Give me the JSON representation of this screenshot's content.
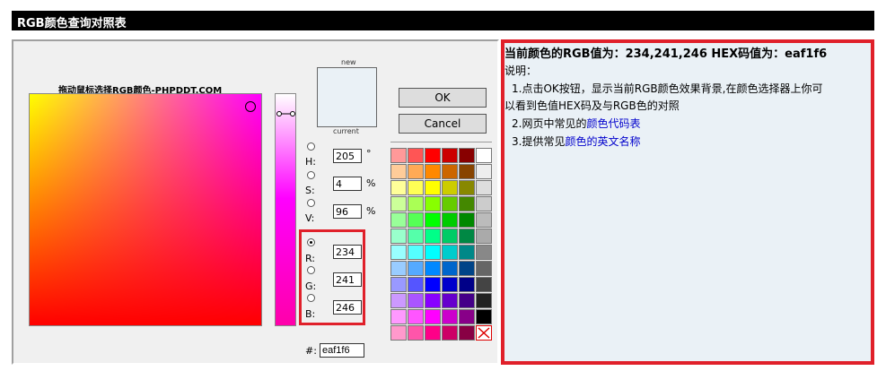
{
  "title": "RGB颜色查询对照表",
  "picker": {
    "drag_caption": "拖动鼠标选择RGB颜色-PHPDDT.COM",
    "new_label": "new",
    "current_label": "current",
    "current_color": "#eaf1f6",
    "ok_label": "OK",
    "cancel_label": "Cancel",
    "channels": {
      "h": {
        "label": "H:",
        "value": "205",
        "unit": "°"
      },
      "s": {
        "label": "S:",
        "value": "4",
        "unit": "%"
      },
      "v": {
        "label": "V:",
        "value": "96",
        "unit": "%"
      },
      "r": {
        "label": "R:",
        "value": "234"
      },
      "g": {
        "label": "G:",
        "value": "241"
      },
      "b": {
        "label": "B:",
        "value": "246"
      }
    },
    "selected_channel": "r",
    "hex_label": "#:",
    "hex_value": "eaf1f6",
    "palette": [
      [
        "#ff9999",
        "#ff5555",
        "#ff0000",
        "#cc0000",
        "#880000",
        "#ffffff"
      ],
      [
        "#ffcc99",
        "#ffaa55",
        "#ff8800",
        "#cc6600",
        "#884400",
        "#eeeeee"
      ],
      [
        "#ffff99",
        "#ffff55",
        "#ffff00",
        "#cccc00",
        "#888800",
        "#dddddd"
      ],
      [
        "#ccff99",
        "#aaff55",
        "#88ff00",
        "#66cc00",
        "#448800",
        "#cccccc"
      ],
      [
        "#99ff99",
        "#55ff55",
        "#00ff00",
        "#00cc00",
        "#008800",
        "#bbbbbb"
      ],
      [
        "#99ffcc",
        "#55ffaa",
        "#00ff88",
        "#00cc66",
        "#008844",
        "#aaaaaa"
      ],
      [
        "#99ffff",
        "#55ffff",
        "#00ffff",
        "#00cccc",
        "#008888",
        "#888888"
      ],
      [
        "#99ccff",
        "#55aaff",
        "#0088ff",
        "#0066cc",
        "#004488",
        "#666666"
      ],
      [
        "#9999ff",
        "#5555ff",
        "#0000ff",
        "#0000cc",
        "#000088",
        "#444444"
      ],
      [
        "#cc99ff",
        "#aa55ff",
        "#8800ff",
        "#6600cc",
        "#440088",
        "#222222"
      ],
      [
        "#ff99ff",
        "#ff55ff",
        "#ff00ff",
        "#cc00cc",
        "#880088",
        "#000000"
      ],
      [
        "#ff99cc",
        "#ff55aa",
        "#ff0088",
        "#cc0066",
        "#880044",
        "none"
      ]
    ]
  },
  "info": {
    "background": "#eaf1f6",
    "title": "当前颜色的RGB值为：234,241,246 HEX码值为：eaf1f6",
    "desc_label": "说明：",
    "line1a": "1.点击OK按钮，显示当前RGB颜色效果背景,在颜色选择器上你可",
    "line1b": "以看到色值HEX码及与RGB色的对照",
    "line2_prefix": "2.网页中常见的",
    "line2_link": "颜色代码表",
    "line3_prefix": "3.提供常见",
    "line3_link": "颜色的英文名称"
  }
}
